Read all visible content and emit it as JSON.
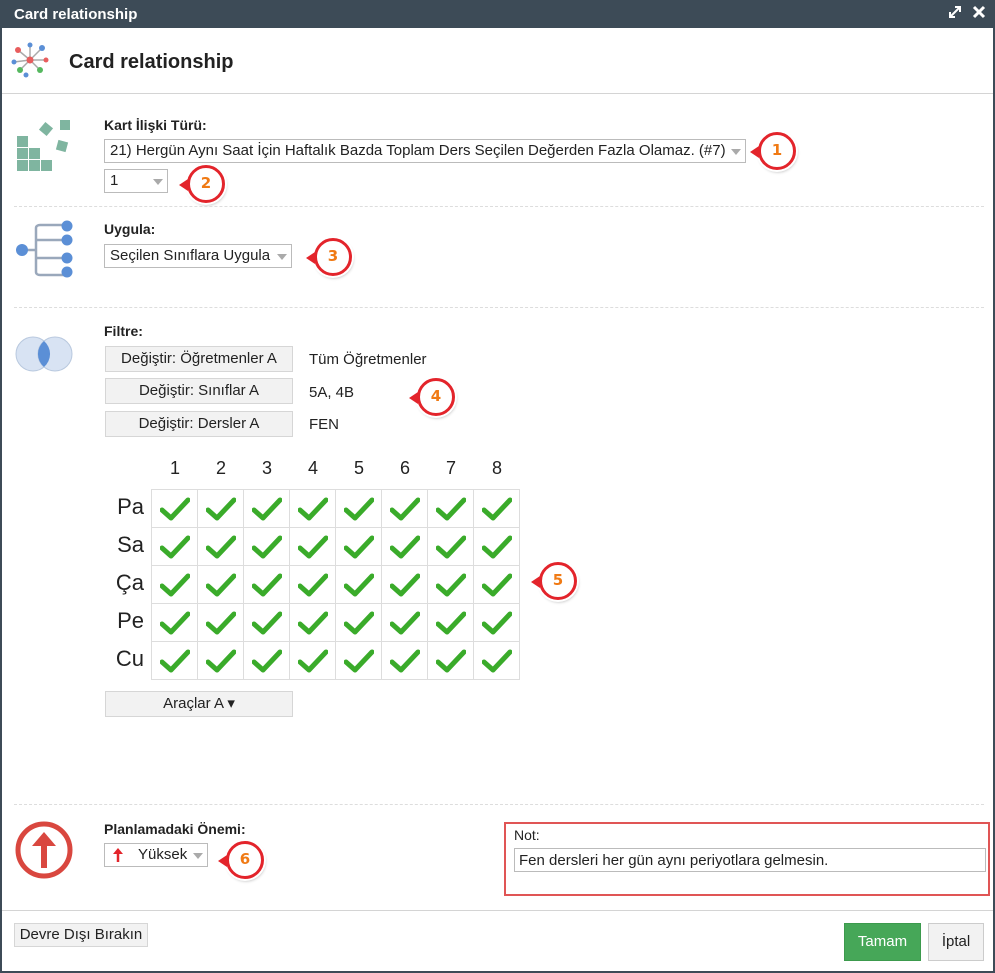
{
  "window": {
    "title": "Card relationship"
  },
  "header": {
    "title": "Card relationship"
  },
  "relation_type": {
    "label": "Kart İlişki Türü:",
    "selected": "21) Hergün Aynı Saat İçin Haftalık Bazda Toplam Ders Seçilen Değerden Fazla Olamaz. (#7)",
    "value_selected": "1"
  },
  "apply": {
    "label": "Uygula:",
    "selected": "Seçilen Sınıflara Uygula"
  },
  "filter": {
    "label": "Filtre:",
    "rows": [
      {
        "button": "Değiştir: Öğretmenler A",
        "value": "Tüm Öğretmenler"
      },
      {
        "button": "Değiştir: Sınıflar A",
        "value": "5A, 4B"
      },
      {
        "button": "Değiştir: Dersler A",
        "value": "FEN"
      }
    ]
  },
  "grid": {
    "columns": [
      "1",
      "2",
      "3",
      "4",
      "5",
      "6",
      "7",
      "8"
    ],
    "rows": [
      "Pa",
      "Sa",
      "Ça",
      "Pe",
      "Cu"
    ],
    "checked": [
      [
        true,
        true,
        true,
        true,
        true,
        true,
        true,
        true
      ],
      [
        true,
        true,
        true,
        true,
        true,
        true,
        true,
        true
      ],
      [
        true,
        true,
        true,
        true,
        true,
        true,
        true,
        true
      ],
      [
        true,
        true,
        true,
        true,
        true,
        true,
        true,
        true
      ],
      [
        true,
        true,
        true,
        true,
        true,
        true,
        true,
        true
      ]
    ],
    "check_color": "#3aab2a"
  },
  "tools": {
    "label": "Araçlar A ▾"
  },
  "importance": {
    "label": "Planlamadaki Önemi:",
    "selected": "Yüksek"
  },
  "note": {
    "label": "Not:",
    "value": "Fen dersleri her gün aynı periyotlara gelmesin."
  },
  "footer": {
    "disable_label": "Devre Dışı Bırakın",
    "ok_label": "Tamam",
    "cancel_label": "İptal"
  },
  "badges": [
    "1",
    "2",
    "3",
    "4",
    "5",
    "6"
  ],
  "colors": {
    "titlebar": "#3d4b57",
    "accent_red": "#e3242b",
    "ok_green": "#46a758",
    "icon_teal": "#7fb5a0",
    "icon_blue": "#5b8fd6"
  }
}
